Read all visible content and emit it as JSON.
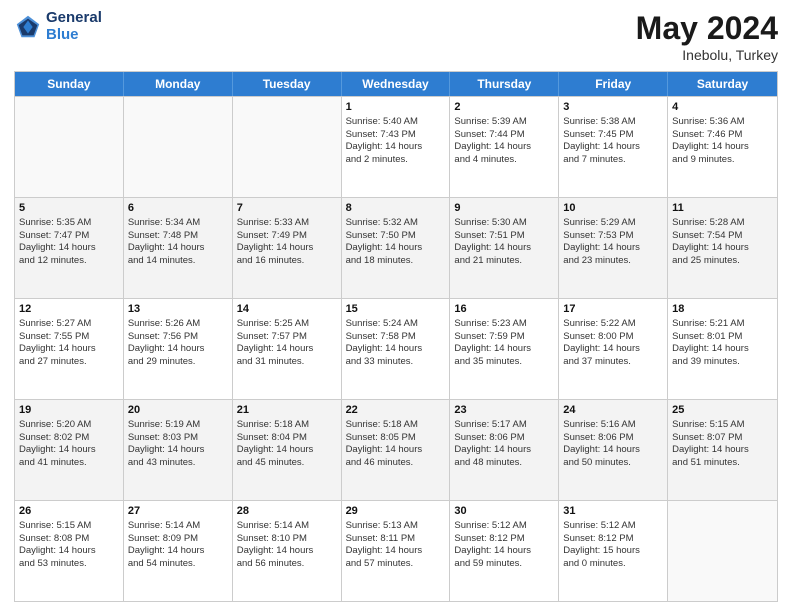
{
  "header": {
    "logo_line1": "General",
    "logo_line2": "Blue",
    "title": "May 2024",
    "location": "Inebolu, Turkey"
  },
  "days_of_week": [
    "Sunday",
    "Monday",
    "Tuesday",
    "Wednesday",
    "Thursday",
    "Friday",
    "Saturday"
  ],
  "weeks": [
    [
      {
        "day": "",
        "info": ""
      },
      {
        "day": "",
        "info": ""
      },
      {
        "day": "",
        "info": ""
      },
      {
        "day": "1",
        "info": "Sunrise: 5:40 AM\nSunset: 7:43 PM\nDaylight: 14 hours\nand 2 minutes."
      },
      {
        "day": "2",
        "info": "Sunrise: 5:39 AM\nSunset: 7:44 PM\nDaylight: 14 hours\nand 4 minutes."
      },
      {
        "day": "3",
        "info": "Sunrise: 5:38 AM\nSunset: 7:45 PM\nDaylight: 14 hours\nand 7 minutes."
      },
      {
        "day": "4",
        "info": "Sunrise: 5:36 AM\nSunset: 7:46 PM\nDaylight: 14 hours\nand 9 minutes."
      }
    ],
    [
      {
        "day": "5",
        "info": "Sunrise: 5:35 AM\nSunset: 7:47 PM\nDaylight: 14 hours\nand 12 minutes."
      },
      {
        "day": "6",
        "info": "Sunrise: 5:34 AM\nSunset: 7:48 PM\nDaylight: 14 hours\nand 14 minutes."
      },
      {
        "day": "7",
        "info": "Sunrise: 5:33 AM\nSunset: 7:49 PM\nDaylight: 14 hours\nand 16 minutes."
      },
      {
        "day": "8",
        "info": "Sunrise: 5:32 AM\nSunset: 7:50 PM\nDaylight: 14 hours\nand 18 minutes."
      },
      {
        "day": "9",
        "info": "Sunrise: 5:30 AM\nSunset: 7:51 PM\nDaylight: 14 hours\nand 21 minutes."
      },
      {
        "day": "10",
        "info": "Sunrise: 5:29 AM\nSunset: 7:53 PM\nDaylight: 14 hours\nand 23 minutes."
      },
      {
        "day": "11",
        "info": "Sunrise: 5:28 AM\nSunset: 7:54 PM\nDaylight: 14 hours\nand 25 minutes."
      }
    ],
    [
      {
        "day": "12",
        "info": "Sunrise: 5:27 AM\nSunset: 7:55 PM\nDaylight: 14 hours\nand 27 minutes."
      },
      {
        "day": "13",
        "info": "Sunrise: 5:26 AM\nSunset: 7:56 PM\nDaylight: 14 hours\nand 29 minutes."
      },
      {
        "day": "14",
        "info": "Sunrise: 5:25 AM\nSunset: 7:57 PM\nDaylight: 14 hours\nand 31 minutes."
      },
      {
        "day": "15",
        "info": "Sunrise: 5:24 AM\nSunset: 7:58 PM\nDaylight: 14 hours\nand 33 minutes."
      },
      {
        "day": "16",
        "info": "Sunrise: 5:23 AM\nSunset: 7:59 PM\nDaylight: 14 hours\nand 35 minutes."
      },
      {
        "day": "17",
        "info": "Sunrise: 5:22 AM\nSunset: 8:00 PM\nDaylight: 14 hours\nand 37 minutes."
      },
      {
        "day": "18",
        "info": "Sunrise: 5:21 AM\nSunset: 8:01 PM\nDaylight: 14 hours\nand 39 minutes."
      }
    ],
    [
      {
        "day": "19",
        "info": "Sunrise: 5:20 AM\nSunset: 8:02 PM\nDaylight: 14 hours\nand 41 minutes."
      },
      {
        "day": "20",
        "info": "Sunrise: 5:19 AM\nSunset: 8:03 PM\nDaylight: 14 hours\nand 43 minutes."
      },
      {
        "day": "21",
        "info": "Sunrise: 5:18 AM\nSunset: 8:04 PM\nDaylight: 14 hours\nand 45 minutes."
      },
      {
        "day": "22",
        "info": "Sunrise: 5:18 AM\nSunset: 8:05 PM\nDaylight: 14 hours\nand 46 minutes."
      },
      {
        "day": "23",
        "info": "Sunrise: 5:17 AM\nSunset: 8:06 PM\nDaylight: 14 hours\nand 48 minutes."
      },
      {
        "day": "24",
        "info": "Sunrise: 5:16 AM\nSunset: 8:06 PM\nDaylight: 14 hours\nand 50 minutes."
      },
      {
        "day": "25",
        "info": "Sunrise: 5:15 AM\nSunset: 8:07 PM\nDaylight: 14 hours\nand 51 minutes."
      }
    ],
    [
      {
        "day": "26",
        "info": "Sunrise: 5:15 AM\nSunset: 8:08 PM\nDaylight: 14 hours\nand 53 minutes."
      },
      {
        "day": "27",
        "info": "Sunrise: 5:14 AM\nSunset: 8:09 PM\nDaylight: 14 hours\nand 54 minutes."
      },
      {
        "day": "28",
        "info": "Sunrise: 5:14 AM\nSunset: 8:10 PM\nDaylight: 14 hours\nand 56 minutes."
      },
      {
        "day": "29",
        "info": "Sunrise: 5:13 AM\nSunset: 8:11 PM\nDaylight: 14 hours\nand 57 minutes."
      },
      {
        "day": "30",
        "info": "Sunrise: 5:12 AM\nSunset: 8:12 PM\nDaylight: 14 hours\nand 59 minutes."
      },
      {
        "day": "31",
        "info": "Sunrise: 5:12 AM\nSunset: 8:12 PM\nDaylight: 15 hours\nand 0 minutes."
      },
      {
        "day": "",
        "info": ""
      }
    ]
  ]
}
